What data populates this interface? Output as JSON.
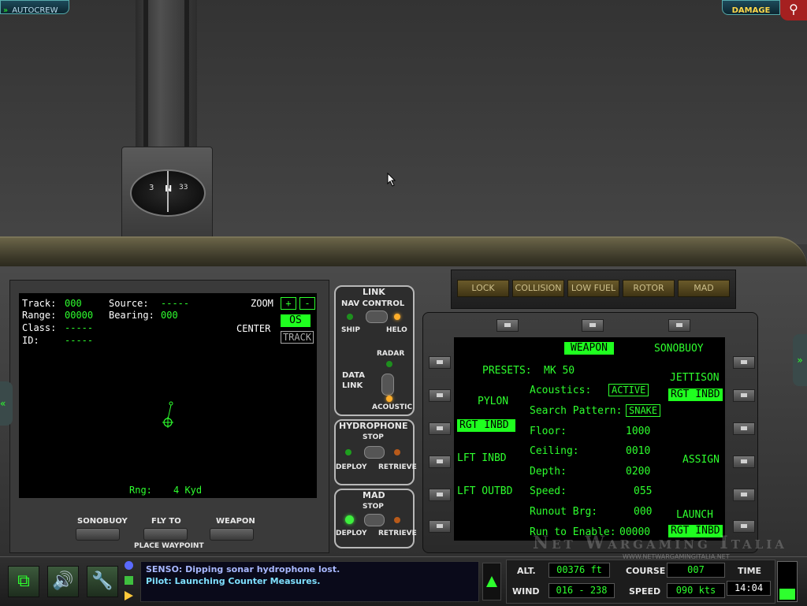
{
  "top": {
    "autocrew_label": "AUTOCREW",
    "damage_label": "DAMAGE"
  },
  "compass": {
    "marks": [
      "3",
      "N",
      "33"
    ]
  },
  "warnings": [
    "LOCK",
    "COLLISION",
    "LOW FUEL",
    "ROTOR",
    "MAD"
  ],
  "tactical": {
    "track_label": "Track:",
    "track_value": "000",
    "source_label": "Source:",
    "source_value": "-----",
    "range_label": "Range:",
    "range_value": "00000",
    "bearing_label": "Bearing:",
    "bearing_value": "000",
    "class_label": "Class:",
    "class_value": "-----",
    "id_label": "ID:",
    "id_value": "-----",
    "zoom_label": "ZOOM",
    "zoom_in": "+",
    "zoom_out": "-",
    "center_label": "CENTER",
    "center_os": "OS",
    "center_track": "TRACK",
    "rng_label": "Rng:",
    "rng_value": "4 Kyd"
  },
  "tactical_buttons": {
    "sonobuoy": "SONOBUOY",
    "fly_to": "FLY TO",
    "weapon": "WEAPON",
    "place_waypoint": "PLACE WAYPOINT"
  },
  "link": {
    "title": "LINK",
    "nav_control": "NAV CONTROL",
    "ship": "SHIP",
    "helo": "HELO",
    "data_link": "DATA LINK",
    "radar": "RADAR",
    "acoustic": "ACOUSTIC"
  },
  "hydrophone": {
    "title": "HYDROPHONE",
    "stop": "STOP",
    "deploy": "DEPLOY",
    "retrieve": "RETRIEVE"
  },
  "mad": {
    "title": "MAD",
    "stop": "STOP",
    "deploy": "DEPLOY",
    "retrieve": "RETRIEVE"
  },
  "weapon_panel": {
    "weapon_tab": "WEAPON",
    "sonobuoy_tab": "SONOBUOY",
    "presets_label": "PRESETS:",
    "presets_value": "MK 50",
    "pylon_label": "PYLON",
    "pylons": [
      "RGT INBD",
      "LFT INBD",
      "LFT OUTBD"
    ],
    "jettison_label": "JETTISON",
    "jettison_value": "RGT INBD",
    "assign_label": "ASSIGN",
    "launch_label": "LAUNCH",
    "launch_value": "RGT INBD",
    "acoustics_label": "Acoustics:",
    "acoustics_value": "ACTIVE",
    "search_label": "Search Pattern:",
    "search_value": "SNAKE",
    "params": [
      {
        "label": "Floor:",
        "value": "1000"
      },
      {
        "label": "Ceiling:",
        "value": "0010"
      },
      {
        "label": "Depth:",
        "value": "0200"
      },
      {
        "label": "Speed:",
        "value": "055"
      },
      {
        "label": "Runout Brg:",
        "value": "000"
      },
      {
        "label": "Run to Enable:",
        "value": "00000"
      }
    ]
  },
  "messages": [
    "SENSO: Dipping sonar hydrophone lost.",
    "Pilot: Launching Counter Measures."
  ],
  "instruments": {
    "alt_label": "ALT.",
    "alt_value": "00376 ft",
    "wind_label": "WIND",
    "wind_value": "016 - 238",
    "course_label": "COURSE",
    "course_value": "007",
    "speed_label": "SPEED",
    "speed_value": "090 kts",
    "time_label": "TIME",
    "time_value": "14:04"
  },
  "watermark": {
    "title": "Net Wargaming Italia",
    "url": "WWW.NETWARGAMINGITALIA.NET"
  },
  "colors": {
    "phosphor": "#2eff2e",
    "message_blue": "#8fb0ff",
    "message_cyan": "#7fe0ff"
  }
}
